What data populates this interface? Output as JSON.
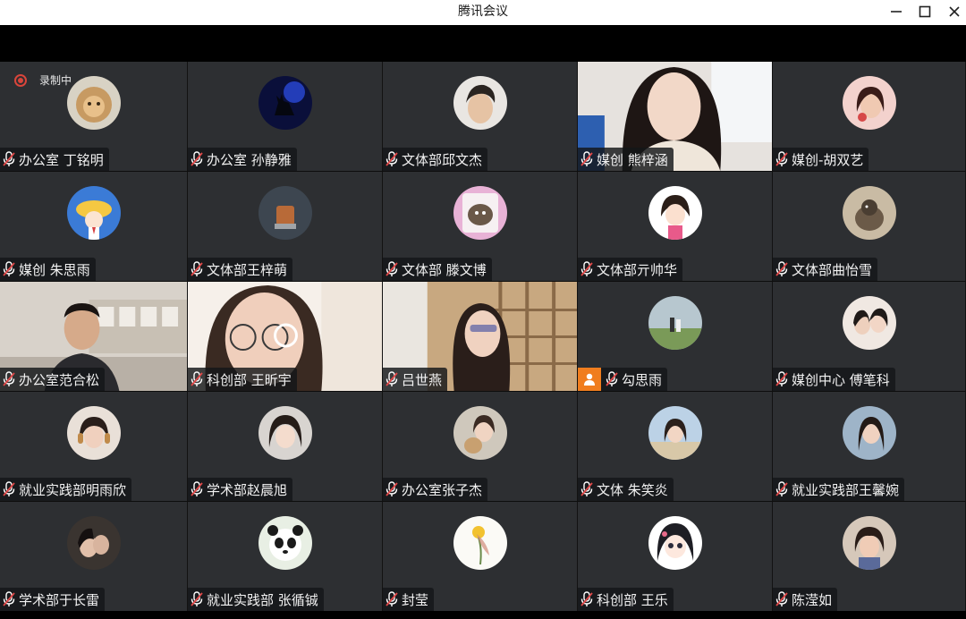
{
  "window": {
    "title": "腾讯会议",
    "controls": [
      "minimize-icon",
      "maximize-icon",
      "close-icon"
    ]
  },
  "recording": {
    "label": "录制中",
    "color": "#d9453b"
  },
  "colors": {
    "tile_bg": "#2d2f32",
    "nametag_bg": "#141619",
    "host_badge": "#f07d1e",
    "mic_muted": "#ffffff"
  },
  "participants": [
    {
      "name": "办公室 丁铭明",
      "avatar": "lion-plush-photo",
      "muted": true
    },
    {
      "name": "办公室 孙静雅",
      "avatar": "blue-deer-silhouette",
      "muted": true
    },
    {
      "name": "文体部邱文杰",
      "avatar": "man-portrait",
      "muted": true
    },
    {
      "name": "媒创 熊梓涵",
      "avatar": "camera-video",
      "muted": true
    },
    {
      "name": "媒创-胡双艺",
      "avatar": "woman-portrait",
      "muted": true
    },
    {
      "name": "媒创 朱思雨",
      "avatar": "cartoon-fish-hat",
      "muted": true
    },
    {
      "name": "文体部王梓萌",
      "avatar": "cup-photo",
      "muted": true
    },
    {
      "name": "文体部 滕文博",
      "avatar": "otter-cartoon",
      "muted": true
    },
    {
      "name": "文体部亓帅华",
      "avatar": "cartoon-girl",
      "muted": true
    },
    {
      "name": "文体部曲怡雪",
      "avatar": "bird-photo",
      "muted": true
    },
    {
      "name": "办公室范合松",
      "avatar": "camera-video",
      "muted": true
    },
    {
      "name": "科创部 王昕宇",
      "avatar": "camera-video",
      "muted": true
    },
    {
      "name": "吕世燕",
      "avatar": "camera-video",
      "muted": true
    },
    {
      "name": "勾思雨",
      "avatar": "couple-field-photo",
      "muted": true,
      "host": true
    },
    {
      "name": "媒创中心 傅笔科",
      "avatar": "two-girls-photo",
      "muted": true
    },
    {
      "name": "就业实践部明雨欣",
      "avatar": "girl-headphones",
      "muted": true
    },
    {
      "name": "学术部赵晨旭",
      "avatar": "girl-selfie",
      "muted": true
    },
    {
      "name": "办公室张子杰",
      "avatar": "girl-with-toy",
      "muted": true
    },
    {
      "name": "文体  朱笑炎",
      "avatar": "girl-beach",
      "muted": true
    },
    {
      "name": "就业实践部王馨婉",
      "avatar": "girl-sky",
      "muted": true
    },
    {
      "name": "学术部于长雷",
      "avatar": "couple-dark",
      "muted": true
    },
    {
      "name": "就业实践部 张循铖",
      "avatar": "panda-photo",
      "muted": true
    },
    {
      "name": "封莹",
      "avatar": "flower-drawing",
      "muted": true
    },
    {
      "name": "科创部 王乐",
      "avatar": "anime-girl",
      "muted": true
    },
    {
      "name": "陈滢如",
      "avatar": "girl-portrait",
      "muted": true
    }
  ]
}
